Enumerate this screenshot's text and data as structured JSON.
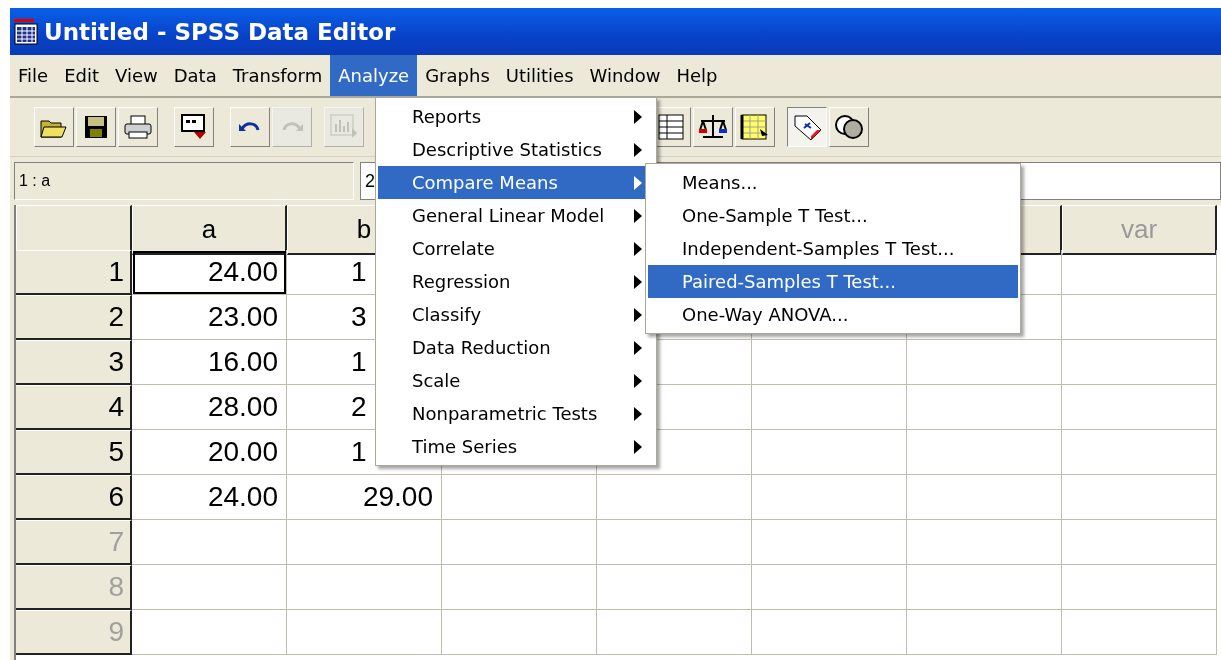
{
  "window": {
    "title": "Untitled - SPSS Data Editor"
  },
  "menu_bar": [
    {
      "label": "File",
      "selected": false
    },
    {
      "label": "Edit",
      "selected": false
    },
    {
      "label": "View",
      "selected": false
    },
    {
      "label": "Data",
      "selected": false
    },
    {
      "label": "Transform",
      "selected": false
    },
    {
      "label": "Analyze",
      "selected": true
    },
    {
      "label": "Graphs",
      "selected": false
    },
    {
      "label": "Utilities",
      "selected": false
    },
    {
      "label": "Window",
      "selected": false
    },
    {
      "label": "Help",
      "selected": false
    }
  ],
  "toolbar": {
    "groups": [
      {
        "buttons": [
          {
            "kind": "open",
            "pressed": false,
            "disabled": false
          },
          {
            "kind": "save",
            "pressed": false,
            "disabled": false
          },
          {
            "kind": "print",
            "pressed": false,
            "disabled": false
          }
        ]
      },
      {
        "buttons": [
          {
            "kind": "recall",
            "pressed": false,
            "disabled": false
          }
        ]
      },
      {
        "buttons": [
          {
            "kind": "undo",
            "pressed": false,
            "disabled": false
          },
          {
            "kind": "redo",
            "pressed": false,
            "disabled": true
          }
        ]
      },
      {
        "buttons": [
          {
            "kind": "chart",
            "pressed": false,
            "disabled": true
          }
        ]
      },
      {
        "buttons": [
          {
            "kind": "grid",
            "pressed": false,
            "disabled": false
          },
          {
            "kind": "scales",
            "pressed": false,
            "disabled": false
          },
          {
            "kind": "insert",
            "pressed": false,
            "disabled": false
          }
        ]
      },
      {
        "buttons": [
          {
            "kind": "tag",
            "pressed": true,
            "disabled": false
          },
          {
            "kind": "circles",
            "pressed": false,
            "disabled": false
          }
        ]
      }
    ]
  },
  "cell_editor": {
    "cell_name": "1 : a",
    "value": "2"
  },
  "grid": {
    "columns": [
      {
        "kind": "variable",
        "label": "a"
      },
      {
        "kind": "variable",
        "label": "b"
      },
      {
        "kind": "covered"
      },
      {
        "kind": "covered"
      },
      {
        "kind": "covered"
      },
      {
        "kind": "blank"
      },
      {
        "kind": "var",
        "label": "var"
      }
    ],
    "rows": [
      {
        "number": "1",
        "empty": false,
        "cells": [
          {
            "text": "24.00",
            "selected": true,
            "clipped": false
          },
          {
            "text": "1",
            "selected": false,
            "clipped": true
          }
        ]
      },
      {
        "number": "2",
        "empty": false,
        "cells": [
          {
            "text": "23.00",
            "selected": false,
            "clipped": false
          },
          {
            "text": "3",
            "selected": false,
            "clipped": true
          }
        ]
      },
      {
        "number": "3",
        "empty": false,
        "cells": [
          {
            "text": "16.00",
            "selected": false,
            "clipped": false
          },
          {
            "text": "1",
            "selected": false,
            "clipped": true
          }
        ]
      },
      {
        "number": "4",
        "empty": false,
        "cells": [
          {
            "text": "28.00",
            "selected": false,
            "clipped": false
          },
          {
            "text": "2",
            "selected": false,
            "clipped": true
          }
        ]
      },
      {
        "number": "5",
        "empty": false,
        "cells": [
          {
            "text": "20.00",
            "selected": false,
            "clipped": false
          },
          {
            "text": "1",
            "selected": false,
            "clipped": true
          }
        ]
      },
      {
        "number": "6",
        "empty": false,
        "cells": [
          {
            "text": "24.00",
            "selected": false,
            "clipped": false
          },
          {
            "text": "29.00",
            "selected": false,
            "clipped": false
          }
        ]
      },
      {
        "number": "7",
        "empty": true,
        "cells": []
      },
      {
        "number": "8",
        "empty": true,
        "cells": []
      },
      {
        "number": "9",
        "empty": true,
        "cells": []
      }
    ]
  },
  "analyze_menu": {
    "items": [
      {
        "label": "Reports",
        "selected": false
      },
      {
        "label": "Descriptive Statistics",
        "selected": false
      },
      {
        "label": "Compare Means",
        "selected": true
      },
      {
        "label": "General Linear Model",
        "selected": false
      },
      {
        "label": "Correlate",
        "selected": false
      },
      {
        "label": "Regression",
        "selected": false
      },
      {
        "label": "Classify",
        "selected": false
      },
      {
        "label": "Data Reduction",
        "selected": false
      },
      {
        "label": "Scale",
        "selected": false
      },
      {
        "label": "Nonparametric Tests",
        "selected": false
      },
      {
        "label": "Time Series",
        "selected": false
      }
    ]
  },
  "compare_means_menu": {
    "items": [
      {
        "label": "Means...",
        "selected": false
      },
      {
        "label": "One-Sample T Test...",
        "selected": false
      },
      {
        "label": "Independent-Samples T Test...",
        "selected": false
      },
      {
        "label": "Paired-Samples T Test...",
        "selected": true
      },
      {
        "label": "One-Way ANOVA...",
        "selected": false
      }
    ]
  }
}
